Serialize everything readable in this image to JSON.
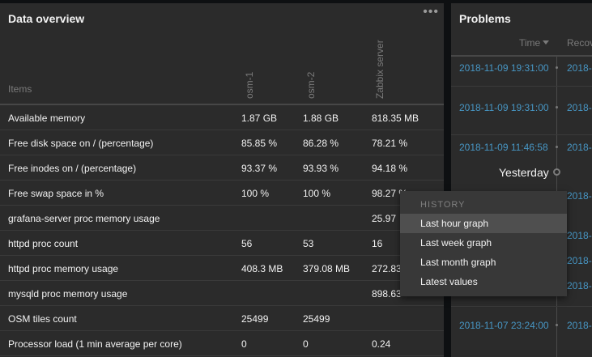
{
  "overview": {
    "title": "Data overview",
    "menu_label": "•••",
    "items_header": "Items",
    "hosts": [
      "osm-1",
      "osm-2",
      "Zabbix server"
    ],
    "rows": [
      {
        "item": "Available memory",
        "v": [
          "1.87 GB",
          "1.88 GB",
          "818.35 MB"
        ]
      },
      {
        "item": "Free disk space on / (percentage)",
        "v": [
          "85.85 %",
          "86.28 %",
          "78.21 %"
        ]
      },
      {
        "item": "Free inodes on / (percentage)",
        "v": [
          "93.37 %",
          "93.93 %",
          "94.18 %"
        ]
      },
      {
        "item": "Free swap space in %",
        "v": [
          "100 %",
          "100 %",
          "98.27 %"
        ]
      },
      {
        "item": "grafana-server proc memory usage",
        "v": [
          "",
          "",
          "25.97"
        ]
      },
      {
        "item": "httpd proc count",
        "v": [
          "56",
          "53",
          "16"
        ]
      },
      {
        "item": "httpd proc memory usage",
        "v": [
          "408.3 MB",
          "379.08 MB",
          "272.83"
        ]
      },
      {
        "item": "mysqld proc memory usage",
        "v": [
          "",
          "",
          "898.63"
        ]
      },
      {
        "item": "OSM tiles count",
        "v": [
          "25499",
          "25499",
          ""
        ]
      },
      {
        "item": "Processor load (1 min average per core)",
        "v": [
          "0",
          "0",
          "0.24"
        ]
      }
    ]
  },
  "problems": {
    "title": "Problems",
    "col_time": "Time",
    "col_recovery": "Recov",
    "rows": [
      {
        "time": "2018-11-09 19:31:00",
        "recovery": "2018-"
      },
      {
        "time": "2018-11-09 19:31:00",
        "recovery": "2018-"
      },
      {
        "time": "2018-11-09 11:46:58",
        "recovery": "2018-"
      },
      {
        "time": "",
        "recovery": "2018-"
      },
      {
        "time": "",
        "recovery": "2018-"
      },
      {
        "time": "",
        "recovery": "2018-"
      },
      {
        "time": "",
        "recovery": "2018-"
      },
      {
        "time": "2018-11-07 23:24:00",
        "recovery": "2018-"
      }
    ],
    "day_separator": "Yesterday"
  },
  "context_menu": {
    "heading": "HISTORY",
    "items": [
      "Last hour graph",
      "Last week graph",
      "Last month graph",
      "Latest values"
    ],
    "active_index": 0
  },
  "colors": {
    "panel_bg": "#2b2b2b",
    "page_bg": "#0e1012",
    "link": "#4796c4",
    "menu_bg": "#383838",
    "menu_hover": "#4f4f4f"
  }
}
